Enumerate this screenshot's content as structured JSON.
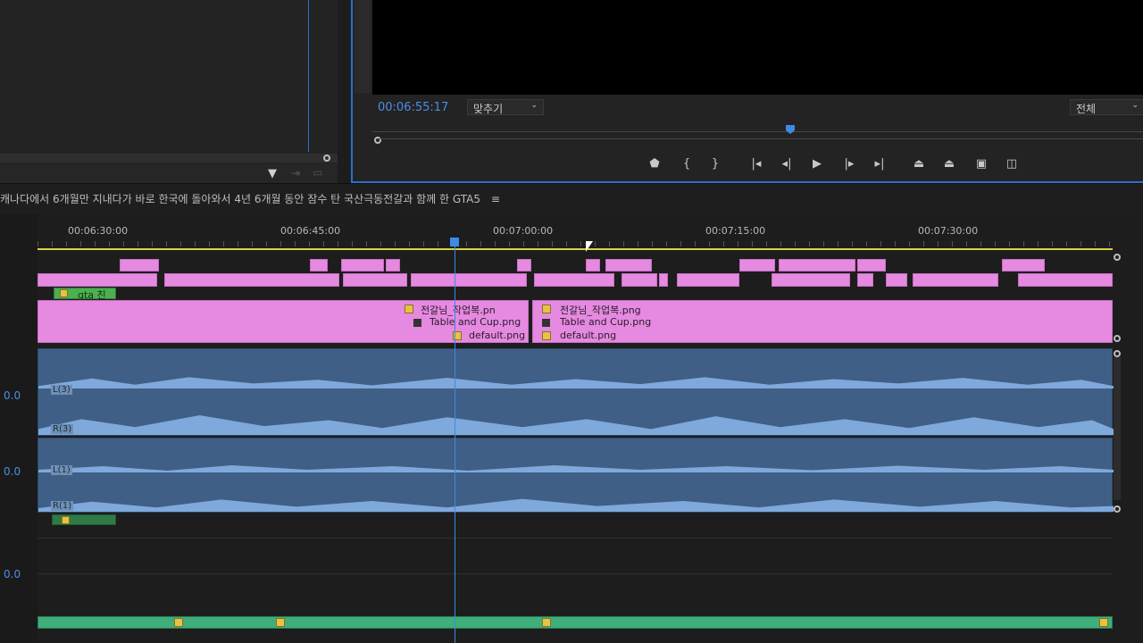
{
  "monitor": {
    "timecode": "00:06:55:17",
    "fit_dropdown": "맞추기",
    "quality_dropdown": "전체"
  },
  "sequence": {
    "title": "캐나다에서 6개월만 지내다가 바로 한국에 돌아와서 4년 6개월 동안 잠수 탄 국산극동전갈과 함께 한 GTA5",
    "menu_icon": "hamburger-icon"
  },
  "ruler": {
    "labels": [
      "00:06:30:00",
      "00:06:45:00",
      "00:07:00:00",
      "00:07:15:00",
      "00:07:30:00"
    ]
  },
  "tracks": {
    "title_clip": "gta 친",
    "image_clips": {
      "left": [
        "전갈님_작업복.pn",
        "Table and Cup.png",
        "default.png"
      ],
      "right": [
        "전갈님_작업복.png",
        "Table and Cup.png",
        "default.png"
      ]
    },
    "volume_values": [
      "0.0",
      "0.0",
      "0.0"
    ],
    "channel_labels": [
      "L(3)",
      "R(3)",
      "L(1)",
      "R(1)"
    ]
  },
  "colors": {
    "accent": "#4a8fe6",
    "clip_pink": "#e58ae0",
    "audio_blue": "#3f5f86",
    "audio_green": "#3fae7a",
    "title_green": "#4caf50"
  }
}
